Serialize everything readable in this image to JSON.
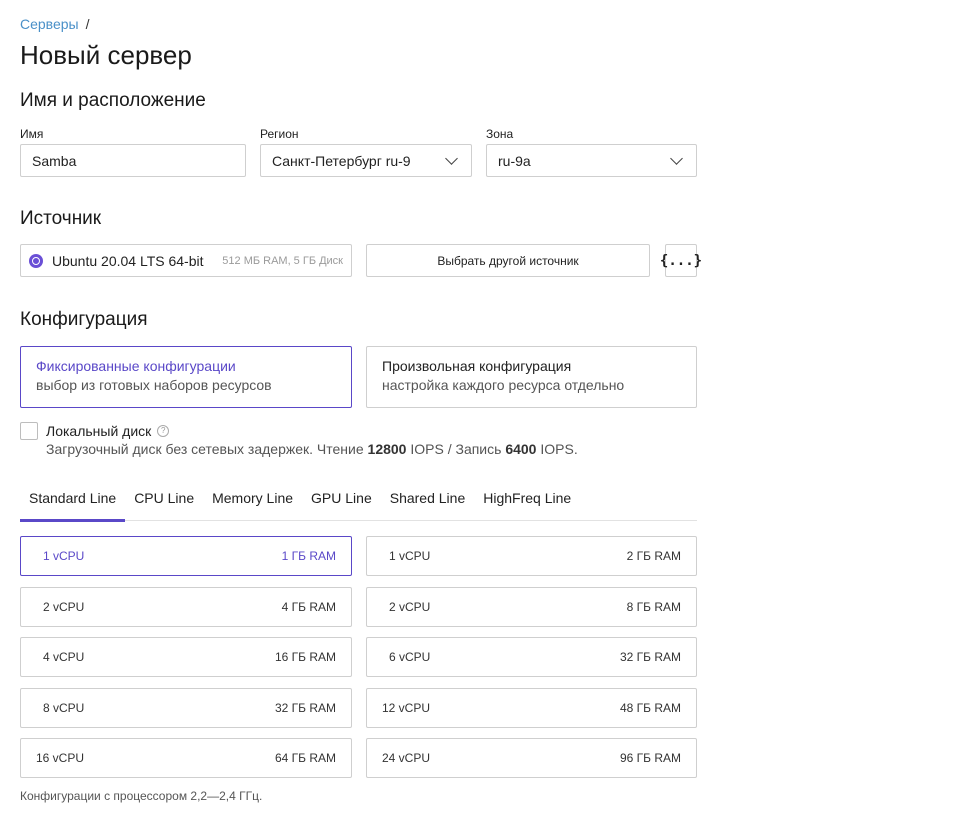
{
  "breadcrumb": {
    "link": "Серверы",
    "separator": "/"
  },
  "page_title": "Новый сервер",
  "location": {
    "section_title": "Имя и расположение",
    "name_label": "Имя",
    "name_value": "Samba",
    "region_label": "Регион",
    "region_value": "Санкт-Петербург ru-9",
    "zone_label": "Зона",
    "zone_value": "ru-9a"
  },
  "source": {
    "section_title": "Источник",
    "image_name": "Ubuntu 20.04 LTS 64-bit",
    "image_meta": "512 МБ RAM, 5 ГБ Диск",
    "choose_label": "Выбрать другой источник",
    "json_label": "{...}",
    "icon": "ubuntu-icon"
  },
  "configuration": {
    "section_title": "Конфигурация",
    "fixed": {
      "title": "Фиксированные конфигурации",
      "desc": "выбор из готовых наборов ресурсов"
    },
    "custom": {
      "title": "Произвольная конфигурация",
      "desc": "настройка каждого ресурса отдельно"
    },
    "local_disk": {
      "label": "Локальный диск",
      "help": "?",
      "desc_prefix": "Загрузочный диск без сетевых задержек. Чтение ",
      "read_iops": "12800",
      "desc_middle": " IOPS / Запись ",
      "write_iops": "6400",
      "desc_suffix": " IOPS.",
      "checked": false
    }
  },
  "tabs": [
    "Standard Line",
    "CPU Line",
    "Memory Line",
    "GPU Line",
    "Shared Line",
    "HighFreq Line"
  ],
  "active_tab": "Standard Line",
  "presets": [
    {
      "cpu": "1 vCPU",
      "ram": "1 ГБ RAM",
      "selected": true
    },
    {
      "cpu": "1 vCPU",
      "ram": "2 ГБ RAM",
      "selected": false
    },
    {
      "cpu": "2 vCPU",
      "ram": "4 ГБ RAM",
      "selected": false
    },
    {
      "cpu": "2 vCPU",
      "ram": "8 ГБ RAM",
      "selected": false
    },
    {
      "cpu": "4 vCPU",
      "ram": "16 ГБ RAM",
      "selected": false
    },
    {
      "cpu": "6 vCPU",
      "ram": "32 ГБ RAM",
      "selected": false
    },
    {
      "cpu": "8 vCPU",
      "ram": "32 ГБ RAM",
      "selected": false
    },
    {
      "cpu": "12 vCPU",
      "ram": "48 ГБ RAM",
      "selected": false
    },
    {
      "cpu": "16 vCPU",
      "ram": "64 ГБ RAM",
      "selected": false
    },
    {
      "cpu": "24 vCPU",
      "ram": "96 ГБ RAM",
      "selected": false
    }
  ],
  "footnote": "Конфигурации с процессором 2,2—2,4 ГГц.",
  "colors": {
    "accent": "#5a48c8",
    "link": "#4a90c8",
    "border": "#cfcfcf"
  }
}
